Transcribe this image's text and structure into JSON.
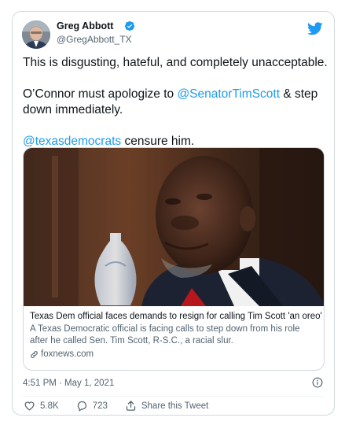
{
  "tweet": {
    "author": {
      "name": "Greg Abbott",
      "handle": "@GregAbbott_TX"
    },
    "text": {
      "line1": "This is disgusting, hateful, and completely unacceptable.",
      "line2_before": "O’Connor must apologize to ",
      "line2_mention": "@SenatorTimScott",
      "line2_after": " & step down immediately.",
      "line3_mention": "@texasdemocrats",
      "line3_after": " censure him."
    },
    "link_card": {
      "title": "Texas Dem official faces demands to resign for calling Tim Scott 'an oreo'",
      "description": "A Texas Democratic official is facing calls to step down from his role after he called Sen. Tim Scott, R-S.C., a racial slur.",
      "domain": "foxnews.com",
      "domain_icon": "link-icon"
    },
    "timestamp": "4:51 PM · May 1, 2021",
    "actions": {
      "likes": "5.8K",
      "replies": "723",
      "share_label": "Share this Tweet"
    }
  },
  "colors": {
    "accent": "#1d9bf0",
    "text": "#0f1419",
    "secondary": "#536471",
    "border": "#cfd9de"
  },
  "icons": [
    "twitter-bird-icon",
    "verified-badge-icon",
    "info-icon",
    "heart-icon",
    "reply-icon",
    "share-icon",
    "link-icon"
  ]
}
